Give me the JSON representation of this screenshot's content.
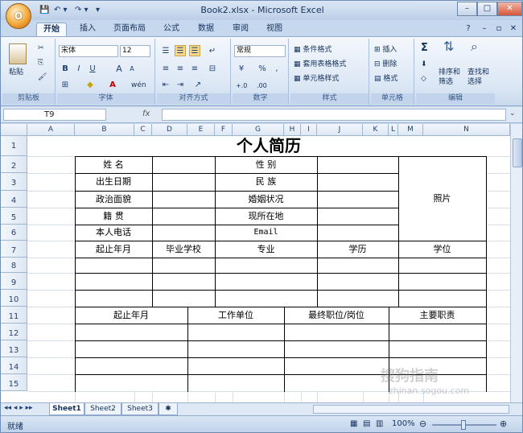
{
  "window": {
    "title": "Book2.xlsx - Microsoft Excel",
    "office_button_glyph": "O",
    "controls": {
      "minimize": "–",
      "maximize": "□",
      "close": "✕"
    }
  },
  "qat": {
    "save": "💾",
    "undo": "↶ ▾",
    "redo": "↷ ▾",
    "customize": "▾"
  },
  "tabs": [
    {
      "label": "开始",
      "active": true
    },
    {
      "label": "插入",
      "active": false
    },
    {
      "label": "页面布局",
      "active": false
    },
    {
      "label": "公式",
      "active": false
    },
    {
      "label": "数据",
      "active": false
    },
    {
      "label": "审阅",
      "active": false
    },
    {
      "label": "视图",
      "active": false
    }
  ],
  "ribbon_right": {
    "help": "?",
    "min": "–",
    "restore": "▫",
    "close": "✕"
  },
  "ribbon": {
    "clipboard": {
      "label": "剪贴板",
      "paste": "粘贴"
    },
    "font": {
      "label": "字体",
      "name": "宋体",
      "size": "12",
      "bold": "B",
      "italic": "I",
      "underline": "U",
      "grow": "A",
      "shrink": "A",
      "wen": "wén"
    },
    "align": {
      "label": "对齐方式"
    },
    "number": {
      "label": "数字",
      "format": "常规",
      "percent": "%",
      "comma": ",",
      "inc": "+.0",
      "dec": ".00"
    },
    "styles": {
      "label": "样式",
      "conditional": "条件格式",
      "table": "套用表格格式",
      "cell": "单元格样式"
    },
    "cells": {
      "label": "单元格",
      "insert": "插入",
      "delete": "删除",
      "format": "格式"
    },
    "editing": {
      "label": "编辑",
      "sum": "Σ",
      "sort": "排序和",
      "sort2": "筛选",
      "find": "查找和",
      "find2": "选择"
    }
  },
  "formula_bar": {
    "cell_ref": "T9",
    "fx": "fx",
    "value": ""
  },
  "columns": [
    "A",
    "B",
    "C",
    "D",
    "E",
    "F",
    "G",
    "H",
    "I",
    "J",
    "K",
    "L",
    "M",
    "N"
  ],
  "rows": [
    "1",
    "2",
    "3",
    "4",
    "5",
    "6",
    "7",
    "8",
    "9",
    "10",
    "11",
    "12",
    "13",
    "14",
    "15"
  ],
  "sheet": {
    "title": "个人简历",
    "name_label": "姓    名",
    "birth_label": "出生日期",
    "politics_label": "政治面貌",
    "origin_label": "籍    贯",
    "phone_label": "本人电话",
    "gender_label": "性    别",
    "ethnic_label": "民    族",
    "marital_label": "婚姻状况",
    "residence_label": "现所在地",
    "email_label": "Email",
    "photo_label": "照片",
    "edu_period": "起止年月",
    "edu_school": "毕业学校",
    "edu_major": "专业",
    "edu_degree": "学历",
    "edu_title": "学位",
    "work_period": "起止年月",
    "work_unit": "工作单位",
    "work_position": "最终职位/岗位",
    "work_duty": "主要职责"
  },
  "sheet_tabs": [
    {
      "label": "Sheet1",
      "active": true
    },
    {
      "label": "Sheet2",
      "active": false
    },
    {
      "label": "Sheet3",
      "active": false
    }
  ],
  "status": {
    "ready": "就绪",
    "zoom": "100%"
  },
  "watermark": {
    "text": "搜狗指南",
    "url": "zhinan.sogou.com"
  }
}
